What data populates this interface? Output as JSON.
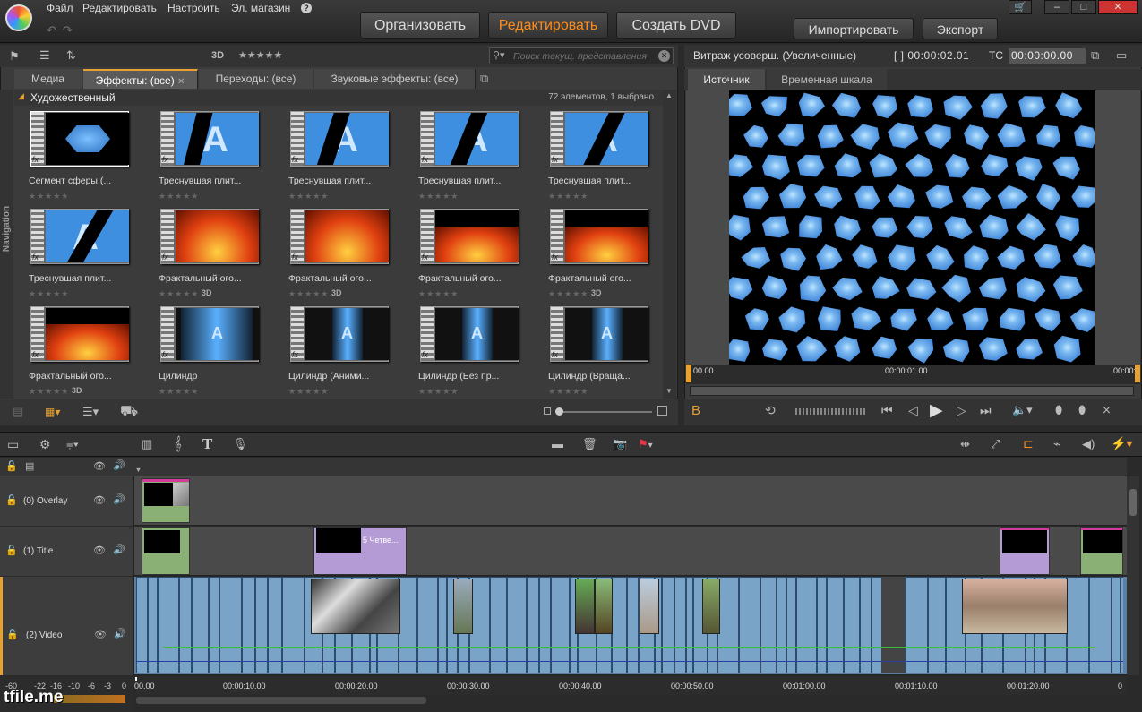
{
  "menu": {
    "file": "Файл",
    "edit": "Редактировать",
    "settings": "Настроить",
    "store": "Эл. магазин",
    "help": "?"
  },
  "modes": {
    "organize": "Организовать",
    "edit": "Редактировать",
    "dvd": "Создать DVD"
  },
  "actions": {
    "import": "Импортировать",
    "export": "Экспорт"
  },
  "library": {
    "search_placeholder": "Поиск текущ. представления",
    "tabs": [
      {
        "label": "Медиа"
      },
      {
        "label": "Эффекты: (все)"
      },
      {
        "label": "Переходы: (все)"
      },
      {
        "label": "Звуковые эффекты: (все)"
      }
    ],
    "category": "Художественный",
    "count": "72 элементов, 1 выбрано",
    "nav_label": "Navigation",
    "three_d": "3D",
    "items": [
      {
        "label": "Сегмент сферы (...",
        "three_d": ""
      },
      {
        "label": "Треснувшая плит...",
        "three_d": ""
      },
      {
        "label": "Треснувшая плит...",
        "three_d": ""
      },
      {
        "label": "Треснувшая плит...",
        "three_d": ""
      },
      {
        "label": "Треснувшая плит...",
        "three_d": ""
      },
      {
        "label": "Треснувшая плит...",
        "three_d": ""
      },
      {
        "label": "Фрактальный ого...",
        "three_d": "3D"
      },
      {
        "label": "Фрактальный ого...",
        "three_d": "3D"
      },
      {
        "label": "Фрактальный ого...",
        "three_d": ""
      },
      {
        "label": "Фрактальный ого...",
        "three_d": "3D"
      },
      {
        "label": "Фрактальный ого...",
        "three_d": "3D"
      },
      {
        "label": "Цилиндр",
        "three_d": ""
      },
      {
        "label": "Цилиндр (Аними...",
        "three_d": ""
      },
      {
        "label": "Цилиндр (Без пр...",
        "three_d": ""
      },
      {
        "label": "Цилиндр (Враща...",
        "three_d": ""
      }
    ]
  },
  "player": {
    "title": "Витраж усоверш. (Увеличенные)",
    "duration": "[ ] 00:00:02.01",
    "tc_label": "TC",
    "tc_value": "00:00:00.00",
    "tabs": {
      "source": "Источник",
      "timeline": "Временная шкала"
    },
    "scrub_start": "00.00",
    "scrub_mid": "00:00:01.00",
    "scrub_end": "00:00:0",
    "b_label": "B"
  },
  "timeline": {
    "tracks": [
      {
        "name": "(0) Overlay"
      },
      {
        "name": "(1) Title"
      },
      {
        "name": "(2) Video"
      }
    ],
    "title_clip": "5 Четве...",
    "ruler": [
      "00.00",
      "00:00:10.00",
      "00:00:20.00",
      "00:00:30.00",
      "00:00:40.00",
      "00:00:50.00",
      "00:01:00.00",
      "00:01:10.00",
      "00:01:20.00",
      "0"
    ],
    "meter": [
      "-60",
      "-22",
      "-16",
      "-10",
      "-6",
      "-3",
      "0"
    ]
  },
  "watermark": "tfile.me",
  "colors": {
    "accent": "#ff8c1a",
    "panel": "#3b3b3b",
    "clip_video": "#7aa3c8",
    "clip_title": "#b59bd6"
  }
}
